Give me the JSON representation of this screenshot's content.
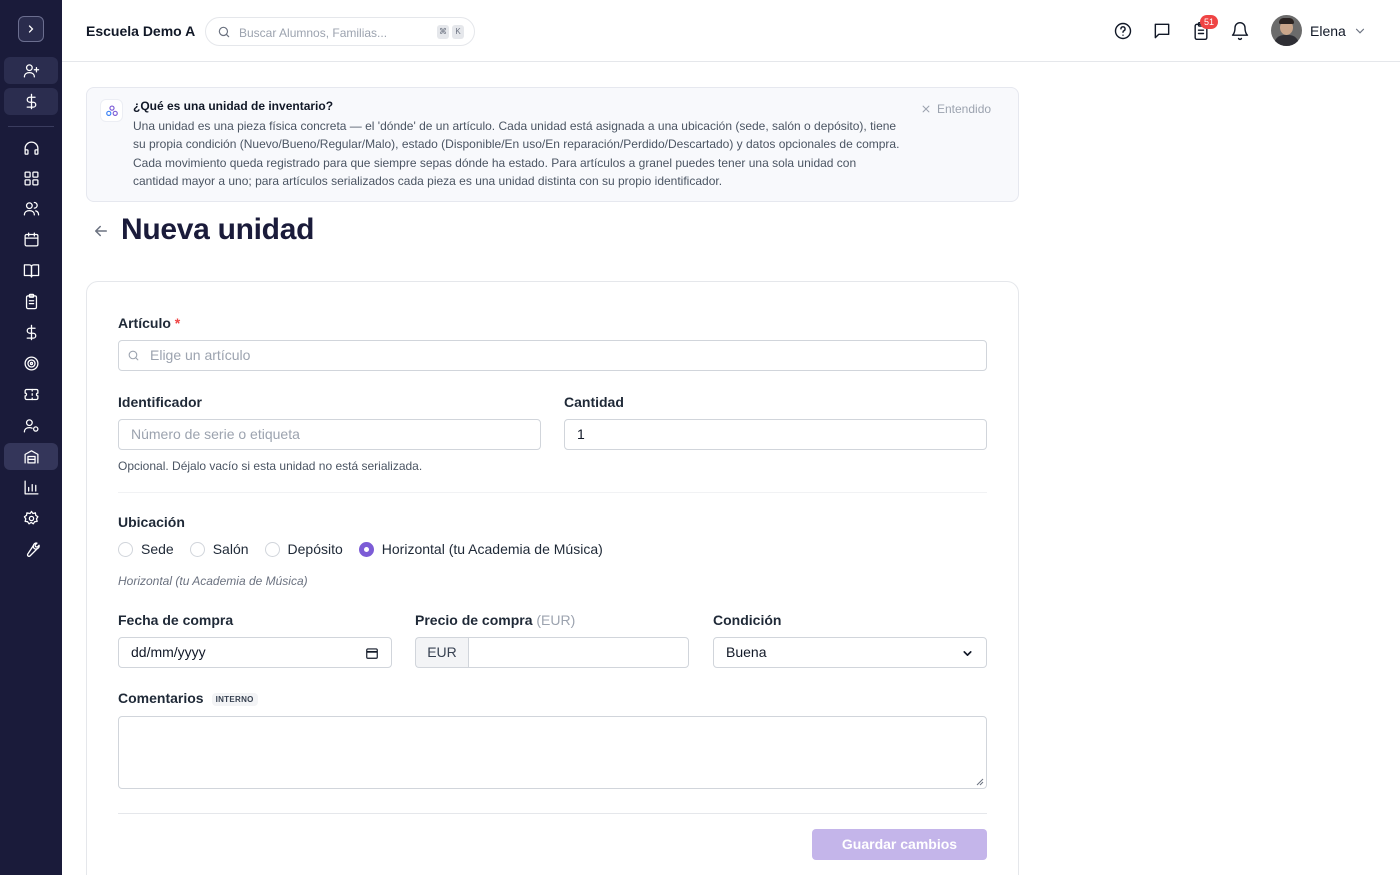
{
  "header": {
    "school_name": "Escuela Demo A",
    "search_placeholder": "Buscar Alumnos, Familias...",
    "shortcut_keys": [
      "⌘",
      "K"
    ],
    "notification_count": "51",
    "user_name": "Elena"
  },
  "sidebar": {
    "items": [
      {
        "icon": "user-plus-icon"
      },
      {
        "icon": "dollar-icon"
      },
      {
        "icon": "headset-icon"
      },
      {
        "icon": "dashboard-icon"
      },
      {
        "icon": "users-icon"
      },
      {
        "icon": "calendar-icon"
      },
      {
        "icon": "book-icon"
      },
      {
        "icon": "clipboard-icon"
      },
      {
        "icon": "dollar-icon"
      },
      {
        "icon": "target-icon"
      },
      {
        "icon": "ticket-icon"
      },
      {
        "icon": "user-cog-icon"
      },
      {
        "icon": "inventory-icon",
        "active": true
      },
      {
        "icon": "bar-chart-icon"
      },
      {
        "icon": "gear-icon"
      },
      {
        "icon": "wrench-icon"
      }
    ]
  },
  "banner": {
    "title": "¿Qué es una unidad de inventario?",
    "text": "Una unidad es una pieza física concreta — el 'dónde' de un artículo. Cada unidad está asignada a una ubicación (sede, salón o depósito), tiene su propia condición (Nuevo/Bueno/Regular/Malo), estado (Disponible/En uso/En reparación/Perdido/Descartado) y datos opcionales de compra. Cada movimiento queda registrado para que siempre sepas dónde ha estado. Para artículos a granel puedes tener una sola unidad con cantidad mayor a uno; para artículos serializados cada pieza es una unidad distinta con su propio identificador.",
    "dismiss_label": "Entendido"
  },
  "page": {
    "title": "Nueva unidad"
  },
  "form": {
    "article": {
      "label": "Artículo",
      "required_mark": "*",
      "placeholder": "Elige un artículo"
    },
    "identifier": {
      "label": "Identificador",
      "placeholder": "Número de serie o etiqueta",
      "help": "Opcional. Déjalo vacío si esta unidad no está serializada."
    },
    "quantity": {
      "label": "Cantidad",
      "value": "1"
    },
    "location": {
      "label": "Ubicación",
      "options": [
        "Sede",
        "Salón",
        "Depósito",
        "Horizontal (tu Academia de Música)"
      ],
      "selected": "Horizontal (tu Academia de Música)",
      "selected_hint": "Horizontal (tu Academia de Música)"
    },
    "purchase_date": {
      "label": "Fecha de compra",
      "placeholder": "dd/mm/yyyy"
    },
    "purchase_price": {
      "label": "Precio de compra",
      "unit_hint": "(EUR)",
      "currency": "EUR",
      "value": ""
    },
    "condition": {
      "label": "Condición",
      "value": "Buena"
    },
    "comments": {
      "label": "Comentarios",
      "tag": "INTERNO",
      "value": ""
    },
    "save_label": "Guardar cambios"
  },
  "colors": {
    "sidebar_bg": "#1a1b3a",
    "accent": "#7c5cd6",
    "button_disabled": "#c4b5ea",
    "badge": "#ef4444"
  }
}
